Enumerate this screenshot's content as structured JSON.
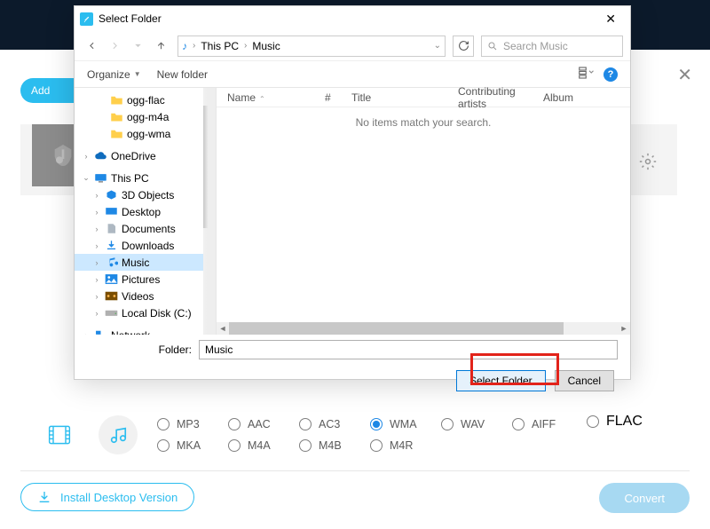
{
  "bg": {
    "add": "Add ",
    "gear": "settings",
    "close": "✕"
  },
  "dialog": {
    "title": "Select Folder",
    "search_ph": "Search Music",
    "toolbar": {
      "organize": "Organize",
      "newfolder": "New folder"
    },
    "breadcrumb": {
      "a": "This PC",
      "b": "Music"
    },
    "tree": {
      "n0": "ogg-flac",
      "n1": "ogg-m4a",
      "n2": "ogg-wma",
      "onedrive": "OneDrive",
      "thispc": "This PC",
      "d3d": "3D Objects",
      "desk": "Desktop",
      "docs": "Documents",
      "down": "Downloads",
      "music": "Music",
      "pics": "Pictures",
      "vids": "Videos",
      "disk": "Local Disk (C:)",
      "network": "Network"
    },
    "cols": {
      "name": "Name",
      "num": "#",
      "title": "Title",
      "contrib": "Contributing artists",
      "album": "Album"
    },
    "empty": "No items match your search.",
    "folder_label": "Folder:",
    "folder_value": "Music",
    "select": "Select Folder",
    "cancel": "Cancel"
  },
  "formats": {
    "mp3": "MP3",
    "aac": "AAC",
    "ac3": "AC3",
    "wma": "WMA",
    "wav": "WAV",
    "aiff": "AIFF",
    "flac": "FLAC",
    "mka": "MKA",
    "m4a": "M4A",
    "m4b": "M4B",
    "m4r": "M4R"
  },
  "install": "Install Desktop Version",
  "convert": "Convert"
}
